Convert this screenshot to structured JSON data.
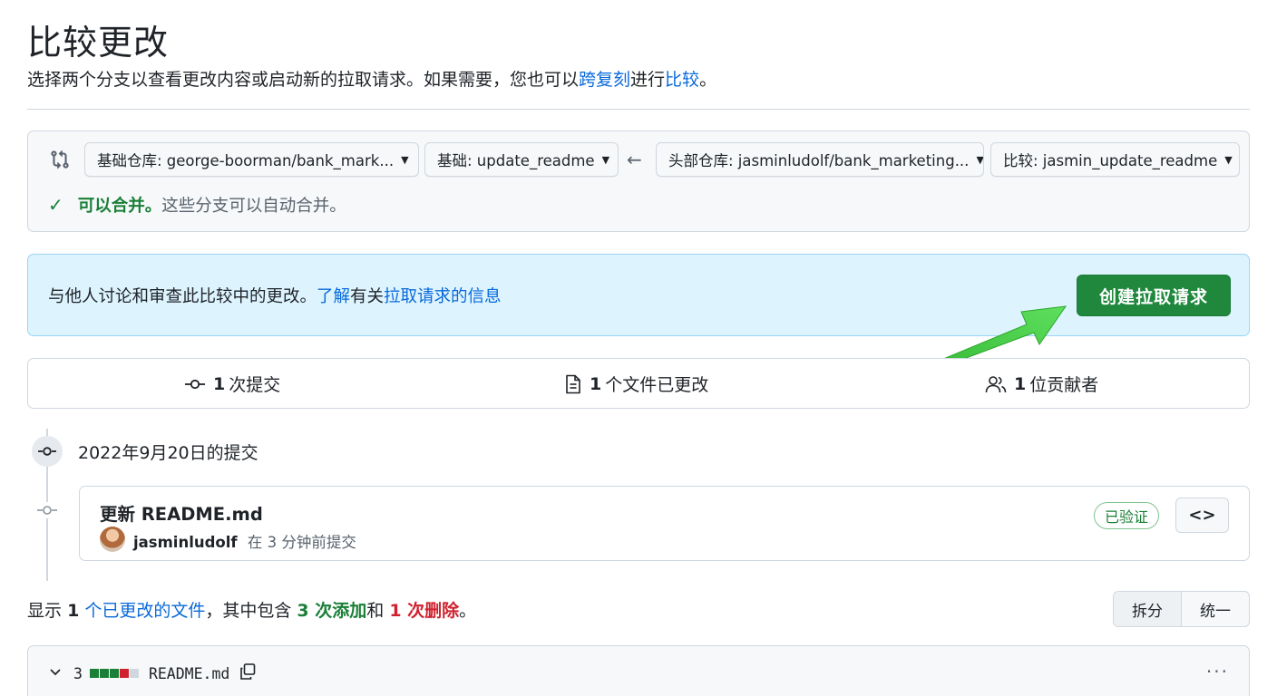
{
  "header": {
    "title": "比较更改",
    "subtitle_before": "选择两个分支以查看更改内容或启动新的拉取请求。如果需要，您也可以",
    "subtitle_link_cross_fork": "跨复刻",
    "subtitle_middle": "进行",
    "subtitle_link_compare": "比较",
    "subtitle_end": "。"
  },
  "range_editor": {
    "base_repo": "基础仓库: george-boorman/bank_mark...",
    "base_branch": "基础: update_readme",
    "arrow": "←",
    "head_repo": "头部仓库: jasminludolf/bank_marketing...",
    "compare_branch": "比较: jasmin_update_readme",
    "merge_ok": "可以合并。",
    "merge_detail": "这些分支可以自动合并。"
  },
  "pr_banner": {
    "text": "与他人讨论和审查此比较中的更改。",
    "learn_link": "了解",
    "text_mid": "有关",
    "info_link": "拉取请求的信息",
    "create_button": "创建拉取请求"
  },
  "stats": {
    "commits_count": "1",
    "commits_label": "次提交",
    "files_count": "1",
    "files_label": "个文件已更改",
    "contributors_count": "1",
    "contributors_label": "位贡献者"
  },
  "timeline": {
    "date_heading": "2022年9月20日的提交",
    "commit": {
      "title": "更新 README.md",
      "author": "jasminludolf",
      "meta": "在 3 分钟前提交",
      "verified": "已验证",
      "browse_icon": "<>"
    }
  },
  "diff_summary": {
    "prefix": "显示",
    "files_count": "1",
    "files_link": "个已更改的文件",
    "middle": "，其中包含",
    "additions": "3 次添加",
    "and": "和",
    "deletions": "1 次删除",
    "end": "。",
    "split_label": "拆分",
    "unified_label": "统一"
  },
  "file": {
    "change_count": "3",
    "name": "README.md",
    "more": "···"
  },
  "colors": {
    "accent_link": "#0969da",
    "success": "#1a7f37",
    "danger": "#cf222e",
    "primary_button": "#1f883d",
    "banner_bg": "#ddf4ff",
    "annotation_arrow": "#3cc83c"
  },
  "icons": {
    "compare": "git-compare-icon",
    "check": "check-icon",
    "commit": "git-commit-icon",
    "file": "file-diff-icon",
    "people": "people-icon",
    "copy": "copy-icon",
    "chevron": "chevron-down-icon",
    "kebab": "kebab-horizontal-icon",
    "code": "code-icon"
  }
}
